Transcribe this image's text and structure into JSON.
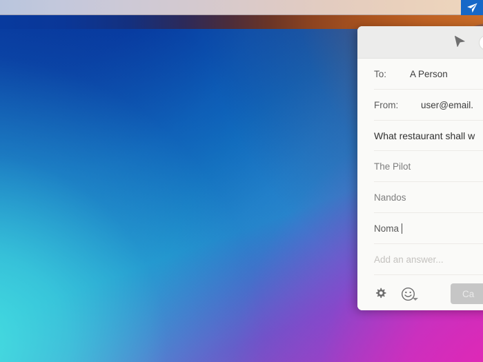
{
  "desktop": {
    "wallpaper_colors": {
      "top_left": "#053096",
      "bottom_left": "#46e1e1",
      "bottom_right": "#e326b4",
      "top_right": "#d66a1e"
    },
    "top_bar": {
      "light_band_left_color": "#b9c5dd",
      "light_band_right_color": "#eed6bd",
      "dark_band_left_color": "#083a9e",
      "dark_band_right_color": "#c96c28"
    },
    "cursor_badge": {
      "icon": "send-cursor-icon",
      "background": "#1668c8",
      "glyph_color": "#ffffff"
    }
  },
  "popup": {
    "header": {
      "cursor_icon": "pointer-arrow-icon",
      "pill_button_label": "",
      "background": "#ececeb"
    },
    "fields": [
      {
        "label": "To:",
        "value": "A Person"
      },
      {
        "label": "From:",
        "value": "user@email."
      }
    ],
    "question": {
      "text": "What restaurant shall w"
    },
    "answers": [
      {
        "text": "The Pilot",
        "active": false
      },
      {
        "text": "Nandos",
        "active": false
      },
      {
        "text": "Noma",
        "active": true
      }
    ],
    "new_answer": {
      "placeholder": "Add an answer..."
    },
    "footer": {
      "settings_icon": "gear-icon",
      "emoji_icon": "smiley-face-icon",
      "emoji_caret_icon": "chevron-down-icon",
      "primary_button_label": "Ca",
      "primary_button_color": "#c6c6c6"
    }
  }
}
